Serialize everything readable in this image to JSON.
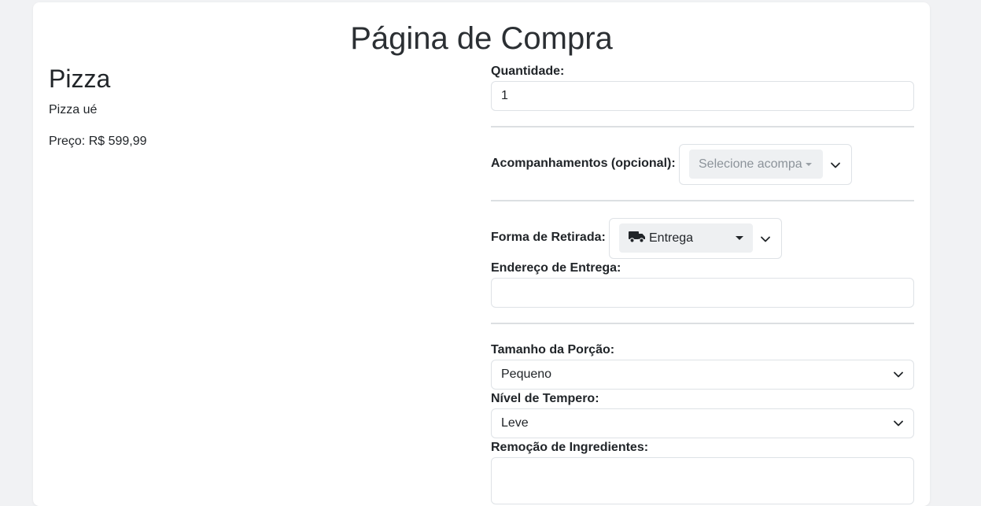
{
  "page": {
    "title": "Página de Compra"
  },
  "product": {
    "name": "Pizza",
    "description": "Pizza ué",
    "price_label": "Preço:",
    "price_value": "R$ 599,99"
  },
  "form": {
    "quantity": {
      "label": "Quantidade:",
      "value": "1"
    },
    "sides": {
      "label": "Acompanhamentos (opcional):",
      "placeholder": "Selecione acompa"
    },
    "pickup": {
      "label": "Forma de Retirada:",
      "value": "Entrega",
      "icon": "truck-icon"
    },
    "address": {
      "label": "Endereço de Entrega:",
      "value": ""
    },
    "portion": {
      "label": "Tamanho da Porção:",
      "value": "Pequeno"
    },
    "spice": {
      "label": "Nível de Tempero:",
      "value": "Leve"
    },
    "removal": {
      "label": "Remoção de Ingredientes:",
      "value": ""
    }
  }
}
